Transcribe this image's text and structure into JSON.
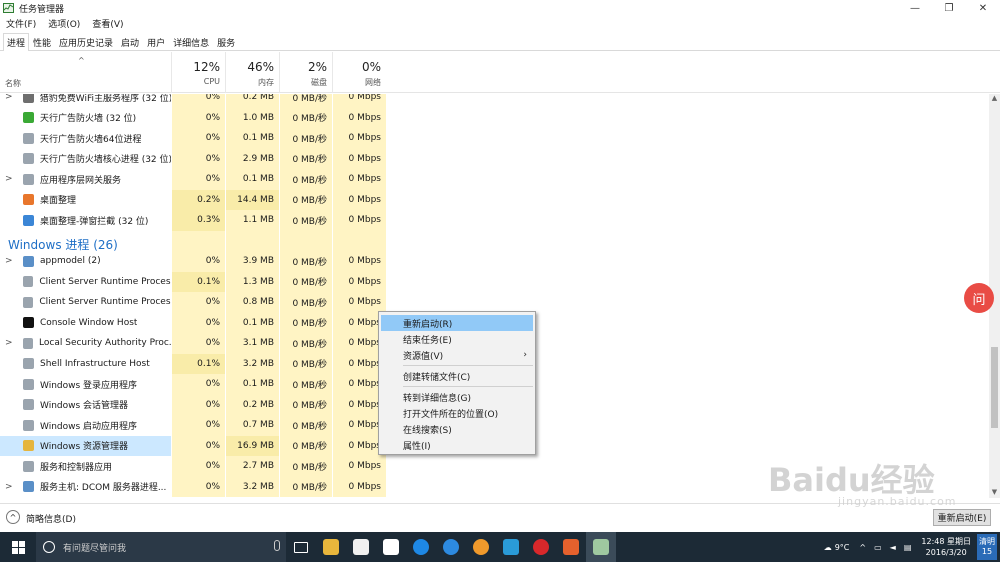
{
  "window": {
    "title": "任务管理器",
    "minimize": "—",
    "maximize": "❐",
    "close": "✕"
  },
  "menu": [
    "文件(F)",
    "选项(O)",
    "查看(V)"
  ],
  "tabs": [
    "进程",
    "性能",
    "应用历史记录",
    "启动",
    "用户",
    "详细信息",
    "服务"
  ],
  "active_tab": 0,
  "header": {
    "sort_arrow": "^",
    "name_label": "名称",
    "columns": [
      {
        "pct": "12%",
        "label": "CPU"
      },
      {
        "pct": "46%",
        "label": "内存"
      },
      {
        "pct": "2%",
        "label": "磁盘"
      },
      {
        "pct": "0%",
        "label": "网络"
      }
    ]
  },
  "rows": [
    {
      "expand": ">",
      "icon": "app-icon",
      "icon_color": "#6e6e6e",
      "name": "猎豹免费WiFi主服务程序 (32 位)",
      "cpu": "0%",
      "mem": "0.2 MB",
      "disk": "0 MB/秒",
      "net": "0 Mbps"
    },
    {
      "expand": "",
      "icon": "shield-icon",
      "icon_color": "#3aa935",
      "name": "天行广告防火墙 (32 位)",
      "cpu": "0%",
      "mem": "1.0 MB",
      "disk": "0 MB/秒",
      "net": "0 Mbps"
    },
    {
      "expand": "",
      "icon": "app-icon",
      "icon_color": "#9aa4ae",
      "name": "天行广告防火墙64位进程",
      "cpu": "0%",
      "mem": "0.1 MB",
      "disk": "0 MB/秒",
      "net": "0 Mbps"
    },
    {
      "expand": "",
      "icon": "app-icon",
      "icon_color": "#9aa4ae",
      "name": "天行广告防火墙核心进程 (32 位)",
      "cpu": "0%",
      "mem": "2.9 MB",
      "disk": "0 MB/秒",
      "net": "0 Mbps"
    },
    {
      "expand": ">",
      "icon": "app-icon",
      "icon_color": "#9aa4ae",
      "name": "应用程序层网关服务",
      "cpu": "0%",
      "mem": "0.1 MB",
      "disk": "0 MB/秒",
      "net": "0 Mbps"
    },
    {
      "expand": "",
      "icon": "desktop-organizer-icon",
      "icon_color": "#e8762c",
      "name": "桌面整理",
      "cpu": "0.2%",
      "mem": "14.4 MB",
      "disk": "0 MB/秒",
      "net": "0 Mbps"
    },
    {
      "expand": "",
      "icon": "popup-block-icon",
      "icon_color": "#3b86d6",
      "name": "桌面整理-弹窗拦截 (32 位)",
      "cpu": "0.3%",
      "mem": "1.1 MB",
      "disk": "0 MB/秒",
      "net": "0 Mbps"
    },
    {
      "group": "Windows 进程 (26)"
    },
    {
      "expand": ">",
      "icon": "gear-icon",
      "icon_color": "#5a8fc7",
      "name": "appmodel (2)",
      "cpu": "0%",
      "mem": "3.9 MB",
      "disk": "0 MB/秒",
      "net": "0 Mbps"
    },
    {
      "expand": "",
      "icon": "app-icon",
      "icon_color": "#9aa4ae",
      "name": "Client Server Runtime Process",
      "cpu": "0.1%",
      "mem": "1.3 MB",
      "disk": "0 MB/秒",
      "net": "0 Mbps"
    },
    {
      "expand": "",
      "icon": "app-icon",
      "icon_color": "#9aa4ae",
      "name": "Client Server Runtime Process",
      "cpu": "0%",
      "mem": "0.8 MB",
      "disk": "0 MB/秒",
      "net": "0 Mbps"
    },
    {
      "expand": "",
      "icon": "console-icon",
      "icon_color": "#111111",
      "name": "Console Window Host",
      "cpu": "0%",
      "mem": "0.1 MB",
      "disk": "0 MB/秒",
      "net": "0 Mbps"
    },
    {
      "expand": ">",
      "icon": "app-icon",
      "icon_color": "#9aa4ae",
      "name": "Local Security Authority Proc...",
      "cpu": "0%",
      "mem": "3.1 MB",
      "disk": "0 MB/秒",
      "net": "0 Mbps"
    },
    {
      "expand": "",
      "icon": "app-icon",
      "icon_color": "#9aa4ae",
      "name": "Shell Infrastructure Host",
      "cpu": "0.1%",
      "mem": "3.2 MB",
      "disk": "0 MB/秒",
      "net": "0 Mbps"
    },
    {
      "expand": "",
      "icon": "app-icon",
      "icon_color": "#9aa4ae",
      "name": "Windows 登录应用程序",
      "cpu": "0%",
      "mem": "0.1 MB",
      "disk": "0 MB/秒",
      "net": "0 Mbps"
    },
    {
      "expand": "",
      "icon": "app-icon",
      "icon_color": "#9aa4ae",
      "name": "Windows 会话管理器",
      "cpu": "0%",
      "mem": "0.2 MB",
      "disk": "0 MB/秒",
      "net": "0 Mbps"
    },
    {
      "expand": "",
      "icon": "app-icon",
      "icon_color": "#9aa4ae",
      "name": "Windows 启动应用程序",
      "cpu": "0%",
      "mem": "0.7 MB",
      "disk": "0 MB/秒",
      "net": "0 Mbps"
    },
    {
      "expand": "",
      "icon": "folder-icon",
      "icon_color": "#e5b53d",
      "name": "Windows 资源管理器",
      "cpu": "0%",
      "mem": "16.9 MB",
      "disk": "0 MB/秒",
      "net": "0 Mbps",
      "selected": true
    },
    {
      "expand": "",
      "icon": "app-icon",
      "icon_color": "#9aa4ae",
      "name": "服务和控制器应用",
      "cpu": "0%",
      "mem": "2.7 MB",
      "disk": "0 MB/秒",
      "net": "0 Mbps"
    },
    {
      "expand": ">",
      "icon": "gear-icon",
      "icon_color": "#5a8fc7",
      "name": "服务主机: DCOM 服务器进程...",
      "cpu": "0%",
      "mem": "3.2 MB",
      "disk": "0 MB/秒",
      "net": "0 Mbps"
    }
  ],
  "context_menu": [
    {
      "label": "重新启动(R)",
      "highlighted": true
    },
    {
      "label": "结束任务(E)"
    },
    {
      "label": "资源值(V)",
      "submenu": "›"
    },
    {
      "separator": true
    },
    {
      "label": "创建转储文件(C)"
    },
    {
      "separator": true
    },
    {
      "label": "转到详细信息(G)"
    },
    {
      "label": "打开文件所在的位置(O)"
    },
    {
      "label": "在线搜索(S)"
    },
    {
      "label": "属性(I)"
    }
  ],
  "footer": {
    "toggle": "^",
    "brief_label": "简略信息(D)",
    "restart_button": "重新启动(E)"
  },
  "colors": {
    "heat_light": "#fff4c4",
    "heat_medium": "#f9eca9",
    "selected": "#cce8ff",
    "accent": "#1f6fc6"
  },
  "taskbar": {
    "search_placeholder": "有问题尽管问我",
    "weather": "9°C",
    "time": "12:48 星期日",
    "date": "2016/3/20",
    "ime_top": "清明",
    "ime_bottom": "15"
  },
  "watermark": {
    "main": "Baidu经验",
    "sub": "jingyan.baidu.com"
  },
  "float_badge": "问"
}
